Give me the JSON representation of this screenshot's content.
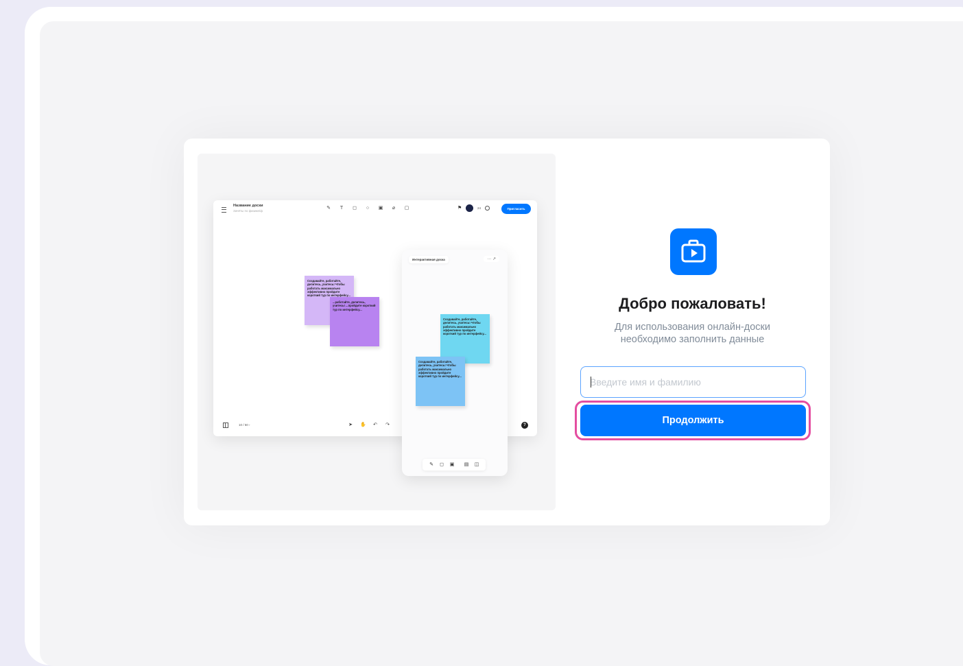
{
  "illustration": {
    "board_title": "Название доски",
    "board_subtitle": "Зачёты по физике/ф",
    "invite_label": "Пригласить",
    "online_count": "24",
    "page_indicator": "10 / 50  ›",
    "mobile_title": "Интерактивная доска",
    "mobile_actions": "··· ↗",
    "notes": [
      {
        "color": "#d4b7f7",
        "text": "Создавайте, работайте, делитесь, учитесь! Чтобы работать максимально эффективно пройдите короткий тур по интерфейсу..."
      },
      {
        "color": "#b883f0",
        "text": "...работайте, делитесь, учитесь! ...пройдите короткий тур по интерфейсу..."
      },
      {
        "color": "#6fd7f1",
        "text": "Создавайте, работайте, делитесь, учитесь! Чтобы работать максимально эффективно пройдите короткий тур по интерфейсу..."
      },
      {
        "color": "#7dc3f5",
        "text": "Создавайте, работайте, делитесь, учитесь! Чтобы работать максимально эффективно пройдите короткий тур по интерфейсу..."
      }
    ]
  },
  "logo": {
    "icon": "briefcase-play-icon",
    "color": "#0077ff"
  },
  "welcome": {
    "title": "Добро пожаловать!",
    "subtitle_line1": "Для использования онлайн-доски",
    "subtitle_line2": "необходимо заполнить данные"
  },
  "form": {
    "name_placeholder": "Введите имя и фамилию",
    "name_value": "",
    "continue_label": "Продолжить",
    "accent": "#0077ff",
    "highlight_color": "#e44da0"
  }
}
